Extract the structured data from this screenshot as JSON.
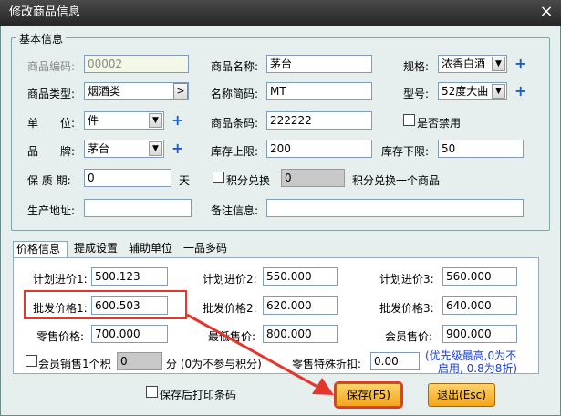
{
  "window": {
    "title": "修改商品信息",
    "close_symbol": "×"
  },
  "basic": {
    "legend": "基本信息",
    "code_label": "商品编码:",
    "code_value": "00002",
    "name_label": "商品名称:",
    "name_value": "茅台",
    "spec_label": "规格:",
    "spec_value": "浓香白酒",
    "type_label": "商品类型:",
    "type_value": "烟酒类",
    "short_label": "名称简码:",
    "short_value": "MT",
    "model_label": "型号:",
    "model_value": "52度大曲",
    "unit_label": "单　　位:",
    "unit_value": "件",
    "barcode_label": "商品条码:",
    "barcode_value": "222222",
    "disabled_label": "是否禁用",
    "brand_label": "品　　牌:",
    "brand_value": "茅台",
    "stock_upper_label": "库存上限:",
    "stock_upper_value": "200",
    "stock_lower_label": "库存下限:",
    "stock_lower_value": "50",
    "shelf_label": "保 质 期:",
    "shelf_value": "0",
    "shelf_unit": "天",
    "points_label": "积分兑换",
    "points_value": "0",
    "points_suffix": "积分兑换一个商品",
    "origin_label": "生产地址:",
    "origin_value": "",
    "remark_label": "备注信息:",
    "remark_value": ""
  },
  "tabs": [
    "价格信息",
    "提成设置",
    "辅助单位",
    "一品多码"
  ],
  "price": {
    "plan1_label": "计划进价1:",
    "plan1_value": "500.123",
    "plan2_label": "计划进价2:",
    "plan2_value": "550.000",
    "plan3_label": "计划进价3:",
    "plan3_value": "560.000",
    "wholesale1_label": "批发价格1:",
    "wholesale1_value": "600.503",
    "wholesale2_label": "批发价格2:",
    "wholesale2_value": "620.000",
    "wholesale3_label": "批发价格3:",
    "wholesale3_value": "640.000",
    "retail_label": "零售价格:",
    "retail_value": "700.000",
    "min_label": "最低售价:",
    "min_value": "800.000",
    "member_label": "会员售价:",
    "member_value": "900.000",
    "member_points_label": "会员销售1个积",
    "member_points_value": "0",
    "member_points_note": "分 (0为不参与积分)",
    "discount_label": "零售特殊折扣:",
    "discount_value": "0.00",
    "discount_note_1": "(优先级最高,0为不",
    "discount_note_2": "启用, 0.8为8折)"
  },
  "footer": {
    "print_label": "保存后打印条码",
    "save_label": "保存(F5)",
    "exit_label": "退出(Esc)"
  },
  "colors": {
    "accent": "#f3a51a",
    "highlight": "#e3362d",
    "note": "#1a3fd0"
  }
}
